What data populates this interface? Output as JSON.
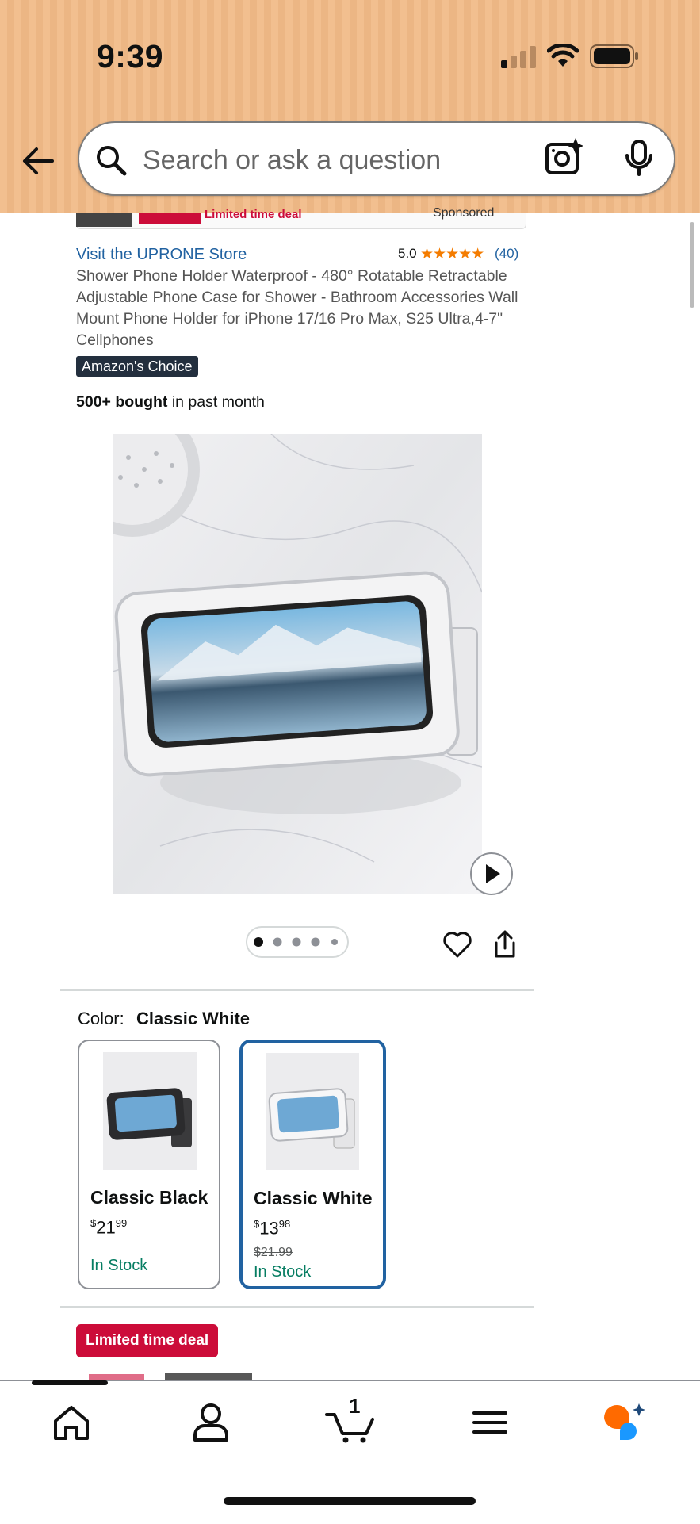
{
  "status_bar": {
    "time": "9:39"
  },
  "search": {
    "placeholder": "Search or ask a question"
  },
  "top_strip": {
    "deal_text": "Limited time deal",
    "sponsored": "Sponsored"
  },
  "product": {
    "store_link": "Visit the UPRONE Store",
    "rating": "5.0",
    "stars": "★★★★★",
    "review_count": "(40)",
    "title": "Shower Phone Holder Waterproof - 480° Rotatable Retractable Adjustable Phone Case for Shower - Bathroom Accessories Wall Mount Phone Holder for iPhone 17/16 Pro Max, S25 Ultra,4-7\" Cellphones",
    "badge": "Amazon's Choice",
    "bought_bold": "500+ bought",
    "bought_rest": " in past month",
    "image_pager": {
      "count": 5,
      "active": 0
    }
  },
  "color": {
    "label": "Color:",
    "selected": "Classic White",
    "options": [
      {
        "name": "Classic Black",
        "price_whole": "21",
        "price_cents": "99",
        "was": "",
        "stock": "In Stock"
      },
      {
        "name": "Classic White",
        "price_whole": "13",
        "price_cents": "98",
        "was": "$21.99",
        "stock": "In Stock"
      }
    ]
  },
  "deal": {
    "badge": "Limited time deal"
  },
  "nav": {
    "items": [
      "home-icon",
      "account-icon",
      "cart-icon",
      "menu-icon",
      "rufus-icon"
    ],
    "cart_count": "1"
  },
  "colors": {
    "header_bg": "#f0bb89",
    "link": "#2162a1",
    "star": "#f47c00",
    "deal": "#cc0c39",
    "stock": "#067d62"
  }
}
